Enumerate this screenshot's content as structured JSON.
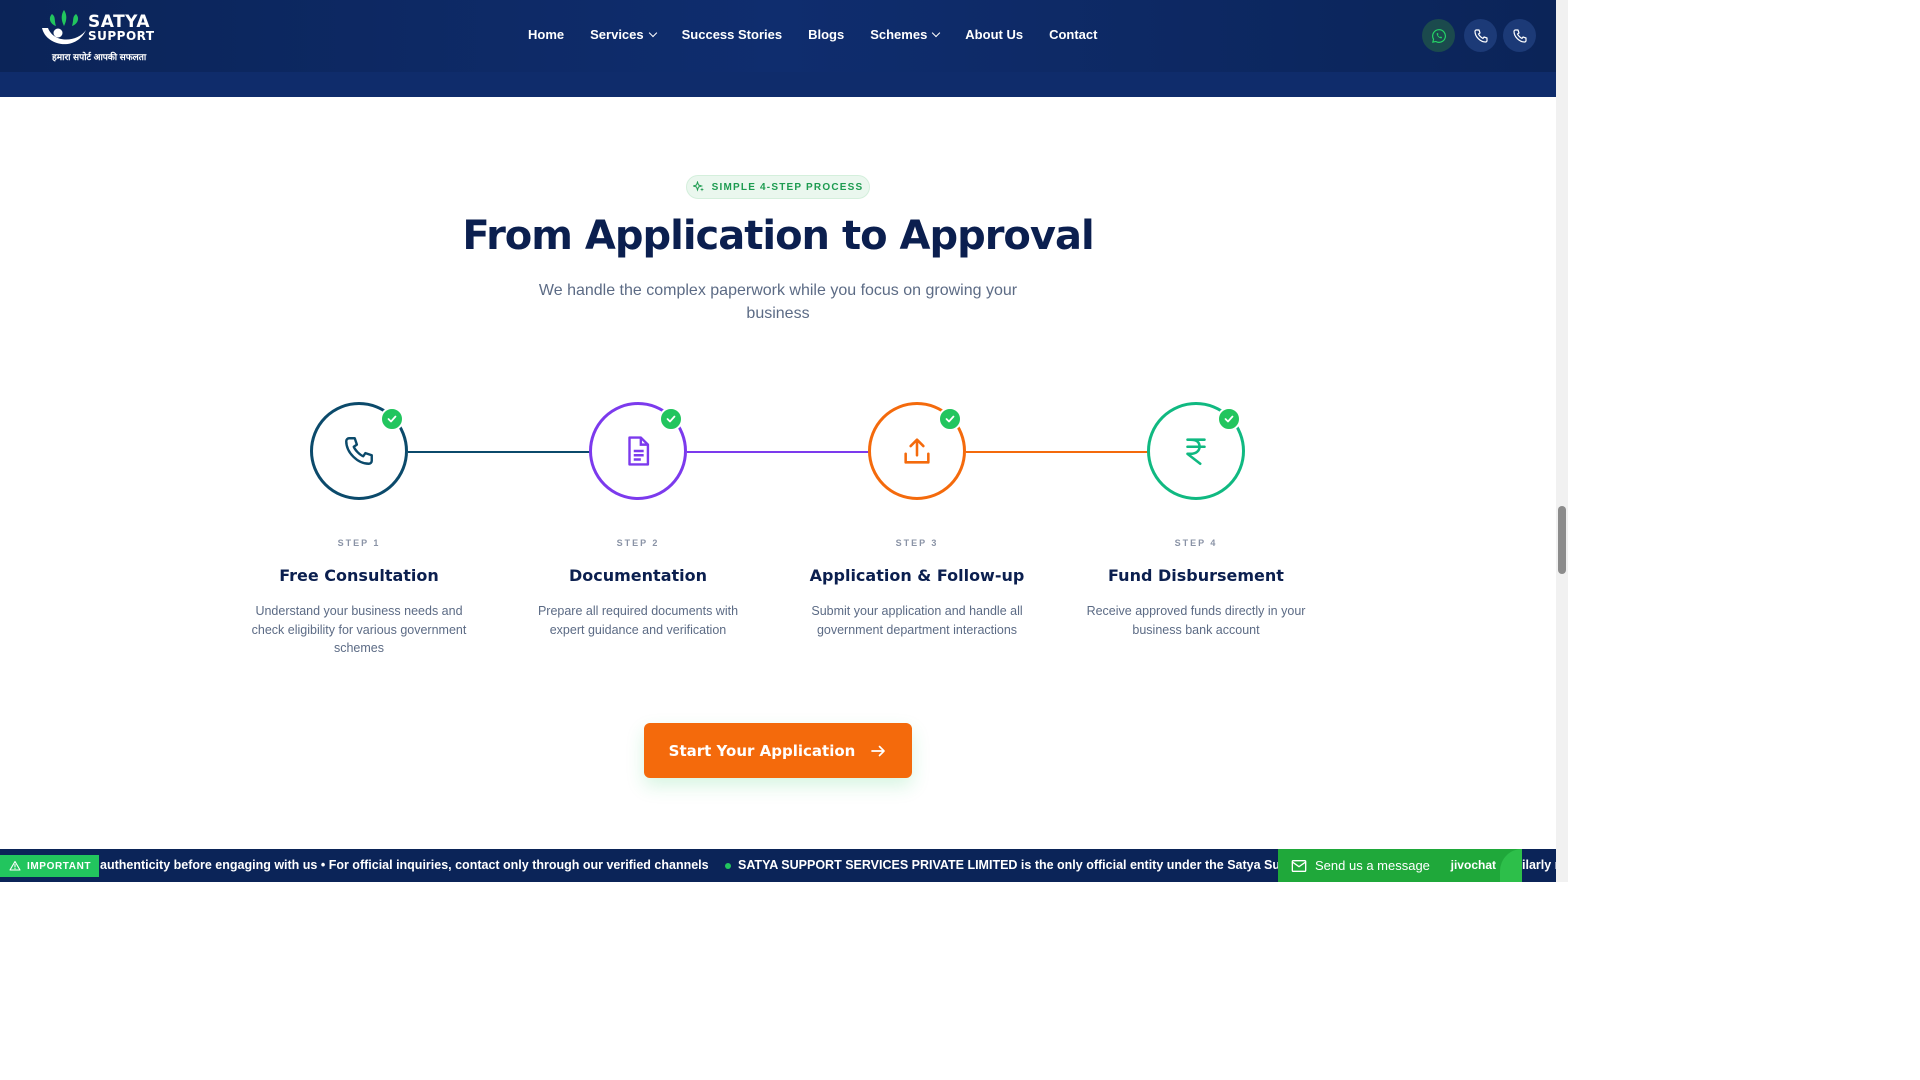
{
  "brand": {
    "name": "SATYA",
    "name2": "SUPPORT",
    "tagline": "हमारा सपोर्ट आपकी सफलता"
  },
  "nav": {
    "items": [
      {
        "label": "Home"
      },
      {
        "label": "Services"
      },
      {
        "label": "Success Stories"
      },
      {
        "label": "Blogs"
      },
      {
        "label": "Schemes"
      },
      {
        "label": "About Us"
      },
      {
        "label": "Contact"
      }
    ]
  },
  "header_actions": [
    "whatsapp-icon",
    "phone-icon",
    "phone-icon"
  ],
  "section": {
    "badge": "SIMPLE 4-STEP PROCESS",
    "title": "From Application to Approval",
    "subtitle": "We handle the complex paperwork while you focus on growing your business"
  },
  "steps": [
    {
      "label": "STEP 1",
      "title": "Free Consultation",
      "description": "Understand your business needs and check eligibility for various government schemes",
      "icon": "phone-icon",
      "color": "#0b4a6b"
    },
    {
      "label": "STEP 2",
      "title": "Documentation",
      "description": "Prepare all required documents with expert guidance and verification",
      "icon": "document-icon",
      "color": "#7c3aed"
    },
    {
      "label": "STEP 3",
      "title": "Application & Follow-up",
      "description": "Submit your application and handle all government department interactions",
      "icon": "upload-icon",
      "color": "#f46a0c"
    },
    {
      "label": "STEP 4",
      "title": "Fund Disbursement",
      "description": "Receive approved funds directly in your business bank account",
      "icon": "rupee-icon",
      "color": "#10b981"
    }
  ],
  "cta": {
    "label": "Start Your Application"
  },
  "ticker": {
    "badge": "IMPORTANT",
    "text1": "authenticity before engaging with us • For official inquiries, contact only through our verified channels",
    "text2": "SATYA SUPPORT SERVICES PRIVATE LIMITED is the only official entity under the Satya Support bran",
    "text3": "ilarly n"
  },
  "chat": {
    "label": "Send us a message",
    "brand": "jivochat"
  },
  "colors": {
    "navy": "#0b2458",
    "accent": "#f46a0c",
    "green": "#22c55e"
  }
}
